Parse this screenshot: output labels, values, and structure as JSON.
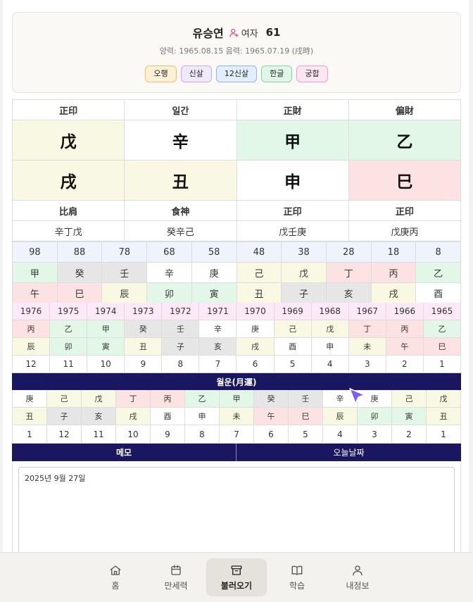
{
  "profile": {
    "name": "유승연",
    "gender": "여자",
    "age": "61",
    "dates": "양력: 1965.08.15 음력: 1965.07.19 (戌時)"
  },
  "tags": [
    {
      "label": "오행",
      "bg": "#fdf0d6",
      "border": "#f0c070"
    },
    {
      "label": "신살",
      "bg": "#f0e8fb",
      "border": "#c9a8ec"
    },
    {
      "label": "12신살",
      "bg": "#e2eefc",
      "border": "#8fb4ea"
    },
    {
      "label": "한글",
      "bg": "#e1f6e6",
      "border": "#87d39b"
    },
    {
      "label": "궁합",
      "bg": "#fce6f2",
      "border": "#ef9ec9"
    }
  ],
  "pillars": {
    "top_labels": [
      "正印",
      "일간",
      "正財",
      "偏財"
    ],
    "stems": [
      "戊",
      "辛",
      "甲",
      "乙"
    ],
    "branches": [
      "戌",
      "丑",
      "申",
      "巳"
    ],
    "bottom_labels": [
      "比肩",
      "食神",
      "正印",
      "正印"
    ],
    "hidden": [
      "辛丁戊",
      "癸辛己",
      "戊壬庚",
      "戊庚丙"
    ]
  },
  "daewoon": {
    "ages": [
      "98",
      "88",
      "78",
      "68",
      "58",
      "48",
      "38",
      "28",
      "18",
      "8"
    ],
    "stems": [
      "甲",
      "癸",
      "壬",
      "辛",
      "庚",
      "己",
      "戊",
      "丁",
      "丙",
      "乙"
    ],
    "branches": [
      "午",
      "巳",
      "辰",
      "卯",
      "寅",
      "丑",
      "子",
      "亥",
      "戌",
      "酉"
    ]
  },
  "seun": {
    "years": [
      "1976",
      "1975",
      "1974",
      "1973",
      "1972",
      "1971",
      "1970",
      "1969",
      "1968",
      "1967",
      "1966",
      "1965"
    ],
    "stems": [
      "丙",
      "乙",
      "甲",
      "癸",
      "壬",
      "辛",
      "庚",
      "己",
      "戊",
      "丁",
      "丙",
      "乙"
    ],
    "branches": [
      "辰",
      "卯",
      "寅",
      "丑",
      "子",
      "亥",
      "戌",
      "酉",
      "申",
      "未",
      "午",
      "巳"
    ],
    "ages": [
      "12",
      "11",
      "10",
      "9",
      "8",
      "7",
      "6",
      "5",
      "4",
      "3",
      "2",
      "1"
    ]
  },
  "wolun": {
    "title": "월운(月運)",
    "stems": [
      "庚",
      "己",
      "戊",
      "丁",
      "丙",
      "乙",
      "甲",
      "癸",
      "壬",
      "辛",
      "庚",
      "己",
      "戊"
    ],
    "branches": [
      "丑",
      "子",
      "亥",
      "戌",
      "酉",
      "申",
      "未",
      "午",
      "巳",
      "辰",
      "卯",
      "寅",
      "丑"
    ],
    "months": [
      "1",
      "12",
      "11",
      "10",
      "9",
      "8",
      "7",
      "6",
      "5",
      "4",
      "3",
      "2",
      "1"
    ]
  },
  "memo_band": {
    "memo": "메모",
    "today": "오늘날짜"
  },
  "memo": {
    "text": "2025년 9월 27일"
  },
  "nav": [
    {
      "label": "홈",
      "icon": "home-icon"
    },
    {
      "label": "만세력",
      "icon": "calendar-icon"
    },
    {
      "label": "불러오기",
      "icon": "archive-icon",
      "active": true
    },
    {
      "label": "학습",
      "icon": "book-icon"
    },
    {
      "label": "내정보",
      "icon": "user-icon"
    }
  ],
  "colors": {
    "band": "#1a1660",
    "accent_pink": "#e0508a",
    "cursor": "#7c5cf5"
  }
}
